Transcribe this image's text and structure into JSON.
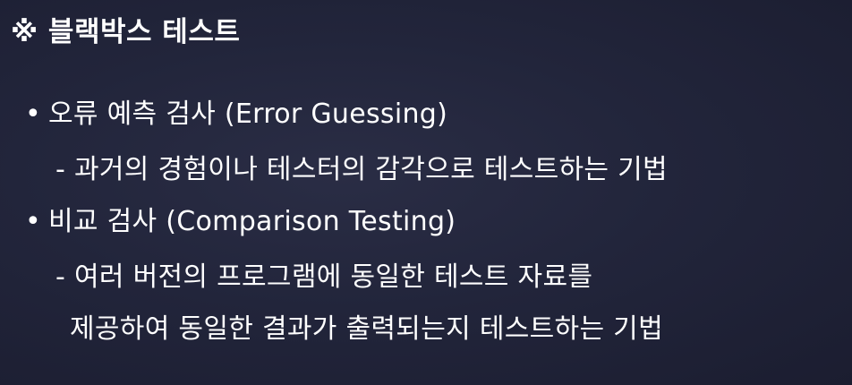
{
  "heading": "※ 블랙박스 테스트",
  "items": [
    {
      "bullet": "•",
      "title": "오류 예측 검사 (Error Guessing)",
      "desc_lines": [
        "- 과거의 경험이나 테스터의 감각으로 테스트하는 기법"
      ]
    },
    {
      "bullet": "•",
      "title": "비교 검사 (Comparison Testing)",
      "desc_lines": [
        "- 여러 버전의 프로그램에 동일한 테스트 자료를",
        "제공하여 동일한 결과가 출력되는지 테스트하는 기법"
      ]
    }
  ]
}
